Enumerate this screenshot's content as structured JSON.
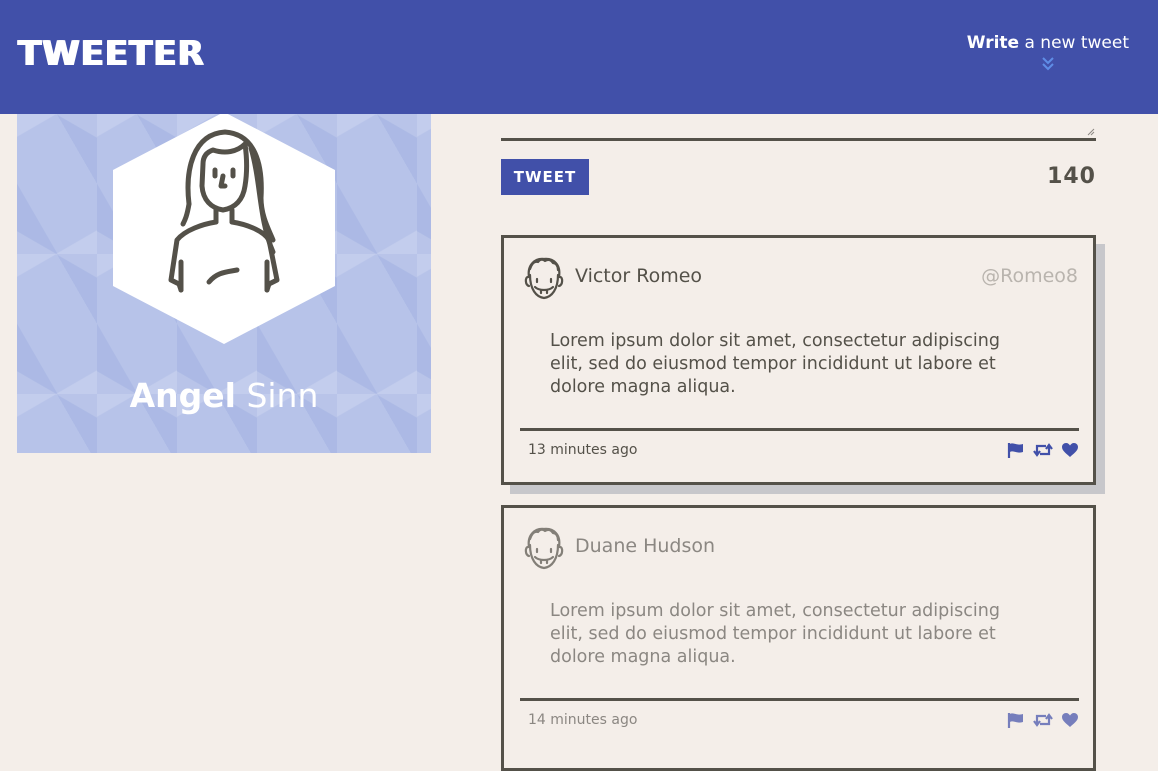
{
  "app": {
    "brand": "TWEETER"
  },
  "header": {
    "compose_strong": "Write",
    "compose_rest": " a new tweet",
    "compose_icon": "double-chevron-down-icon"
  },
  "profile": {
    "first_name": "Angel",
    "last_name": " Sinn",
    "avatar_icon": "female-avatar-icon"
  },
  "composer": {
    "button_label": "TWEET",
    "counter": "140"
  },
  "tweets": [
    {
      "author": "Victor Romeo",
      "handle": "@Romeo8",
      "text": "Lorem ipsum dolor sit amet, consectetur adipiscing elit, sed do eiusmod tempor incididunt ut labore et dolore magna aliqua.",
      "time": "13 minutes ago",
      "actions": [
        "flag-icon",
        "retweet-icon",
        "heart-icon"
      ]
    },
    {
      "author": "Duane Hudson",
      "handle": "",
      "text": "Lorem ipsum dolor sit amet, consectetur adipiscing elit, sed do eiusmod tempor incididunt ut labore et dolore magna aliqua.",
      "time": "14 minutes ago",
      "actions": [
        "flag-icon",
        "retweet-icon",
        "heart-icon"
      ]
    }
  ],
  "colors": {
    "brand": "#4150a9",
    "background": "#f4eee9",
    "text": "#545149",
    "profile_bg": "#b7c3e9",
    "muted": "#b9b4ae",
    "shadow": "#c7c7cb"
  }
}
